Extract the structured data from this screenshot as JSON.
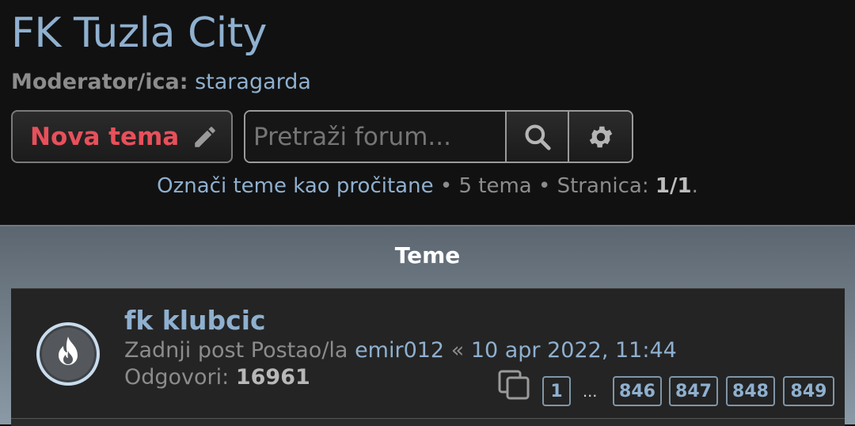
{
  "header": {
    "forum_title": "FK Tuzla City",
    "moderator_label": "Moderator/ica:",
    "moderator_name": "staragarda"
  },
  "toolbar": {
    "new_topic_label": "Nova tema",
    "new_topic_icon": "pencil-icon",
    "search_placeholder": "Pretraži forum...",
    "search_icon": "search-icon",
    "advanced_search_icon": "gear-icon"
  },
  "info": {
    "mark_read_link": "Označi teme kao pročitane",
    "sep1": " • ",
    "topic_count": "5 tema",
    "sep2": " • ",
    "page_label": "Stranica: ",
    "page_value": "1/1",
    "end": "."
  },
  "panel": {
    "title": "Teme"
  },
  "topics": [
    {
      "title": "fk klubcic",
      "icon": "hot-topic-flame-icon",
      "last_post_prefix": "Zadnji post Postao/la ",
      "last_post_user": "emir012",
      "last_post_sep": " « ",
      "last_post_time": "10 apr 2022, 11:44",
      "replies_label": "Odgovori: ",
      "replies_count": "16961",
      "pagination_icon": "pages-icon",
      "pages": [
        "1",
        "846",
        "847",
        "848",
        "849"
      ],
      "pages_ellipsis": "..."
    }
  ],
  "colors": {
    "background": "#111111",
    "link": "#8fb0cf",
    "accent_red": "#e8505b",
    "muted_text": "#8c8c8c",
    "row_bg": "#242424"
  }
}
